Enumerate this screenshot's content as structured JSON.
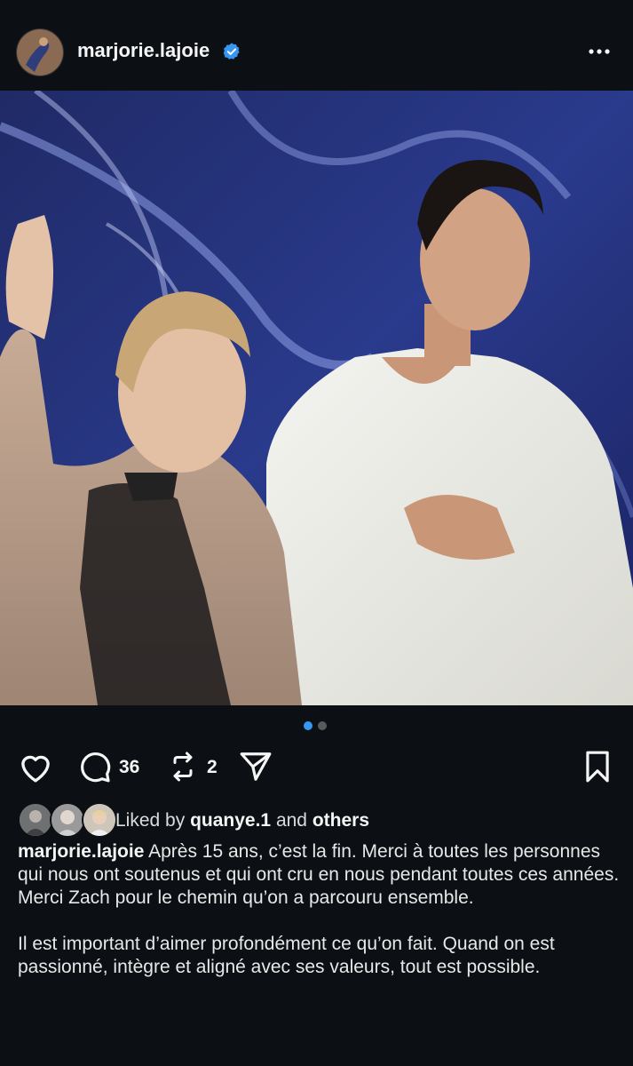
{
  "post": {
    "username": "marjorie.lajoie",
    "verified": true,
    "media": {
      "description": "Ice dancers waving on podium",
      "carousel_count": 2,
      "carousel_active": 1
    },
    "actions": {
      "like_icon": "heart-icon",
      "comment_icon": "comment-icon",
      "comment_count": "36",
      "repost_icon": "repost-icon",
      "repost_count": "2",
      "share_icon": "send-icon",
      "save_icon": "bookmark-icon"
    },
    "likes": {
      "prefix": "Liked by",
      "user": "quanye.1",
      "conjunction": "and",
      "others": "others"
    },
    "caption": {
      "author": "marjorie.lajoie",
      "paragraph1": "Après 15 ans, c’est la fin. Merci à toutes les personnes qui nous ont soutenus et qui ont cru en nous pendant toutes ces années. Merci Zach pour le chemin qu’on a parcouru ensemble.",
      "paragraph2": "Il est important d’aimer profondément ce qu’on fait. Quand on est passionné, intègre et aligné avec ses valeurs, tout est possible."
    }
  },
  "colors": {
    "background": "#0c1014",
    "accent": "#3797f0",
    "text": "#f5f5f5"
  }
}
